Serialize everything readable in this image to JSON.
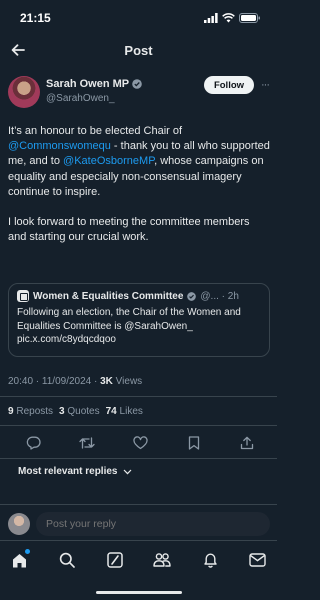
{
  "status_bar": {
    "time": "21:15"
  },
  "header": {
    "title": "Post"
  },
  "author": {
    "name": "Sarah Owen MP",
    "handle": "@SarahOwen_",
    "follow_label": "Follow",
    "more_label": "···"
  },
  "tweet": {
    "p1_a": "It’s an honour to be elected Chair of ",
    "p1_m1": "@Commonswomequ",
    "p1_b": " - thank you to all who supported me, and to ",
    "p1_m2": "@KateOsborneMP",
    "p1_c": ", whose campaigns on equality and especially non-consensual imagery continue to inspire.",
    "p2": "I look forward to meeting the committee members and starting our crucial work."
  },
  "quote": {
    "name": "Women & Equalities Committee",
    "meta": "@... · 2h",
    "body": "Following an election, the Chair of the Women and Equalities Committee is @SarahOwen_ pic.x.com/c8ydqcdqoo"
  },
  "timestamp": {
    "time": "20:40 · 11/09/2024 · ",
    "views": "3K",
    "views_label": " Views"
  },
  "stats": {
    "reposts": "9",
    "reposts_label": "Reposts",
    "quotes": "3",
    "quotes_label": "Quotes",
    "likes": "74",
    "likes_label": "Likes"
  },
  "sort": {
    "label": "Most relevant replies"
  },
  "reply_bar": {
    "placeholder": "Post your reply"
  },
  "colors": {
    "background": "#15202b",
    "accent": "#1d9bf0",
    "muted": "#8b98a5",
    "border": "#38444d"
  },
  "icons": [
    "back-arrow-icon",
    "verified-badge-icon",
    "reply-icon",
    "repost-icon",
    "like-icon",
    "bookmark-icon",
    "share-icon",
    "home-icon",
    "search-icon",
    "grok-icon",
    "communities-icon",
    "notifications-icon",
    "messages-icon"
  ]
}
